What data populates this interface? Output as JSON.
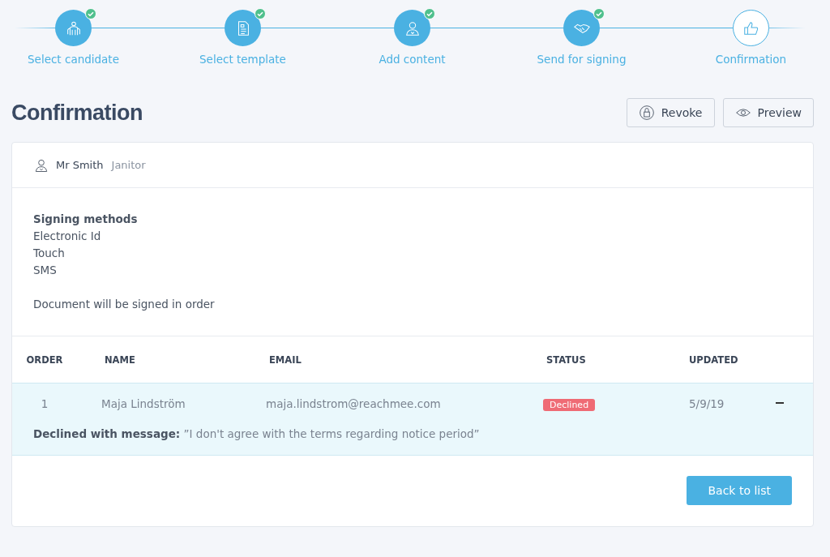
{
  "steps": [
    {
      "label": "Select candidate",
      "kind": "people",
      "completed": true,
      "current": false
    },
    {
      "label": "Select template",
      "kind": "document",
      "completed": true,
      "current": false
    },
    {
      "label": "Add content",
      "kind": "person",
      "completed": true,
      "current": false
    },
    {
      "label": "Send for signing",
      "kind": "handshake",
      "completed": true,
      "current": false
    },
    {
      "label": "Confirmation",
      "kind": "thumb",
      "completed": false,
      "current": true
    }
  ],
  "title": "Confirmation",
  "actions": [
    {
      "label": "Revoke",
      "kind": "lock"
    },
    {
      "label": "Preview",
      "kind": "eye"
    }
  ],
  "candidate": {
    "name": "Mr Smith",
    "role": "Janitor"
  },
  "signing": {
    "heading": "Signing methods",
    "methods": [
      "Electronic Id",
      "Touch",
      "SMS"
    ],
    "note": "Document will be signed in order"
  },
  "table": {
    "columns": [
      "ORDER",
      "NAME",
      "EMAIL",
      "STATUS",
      "UPDATED"
    ],
    "rows": [
      {
        "order": "1",
        "name": "Maja Lindström",
        "email": "maja.lindstrom@reachmee.com",
        "status": "Declined",
        "color": "#ef6b75",
        "updated": "5/9/19",
        "expanded": true,
        "message": "**Declined with message:** ”I don't agree with the terms regarding notice period”"
      }
    ]
  },
  "footer_button": "Back to list"
}
